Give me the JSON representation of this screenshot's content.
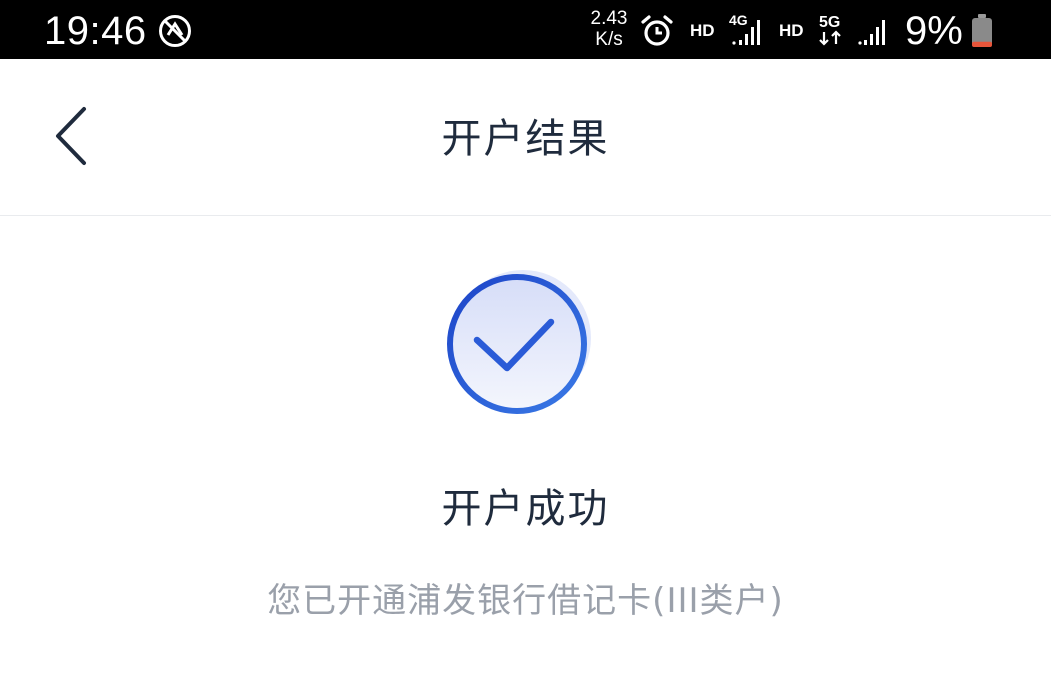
{
  "status_bar": {
    "time": "19:46",
    "net_speed_value": "2.43",
    "net_speed_unit": "K/s",
    "hd_label_1": "HD",
    "network_1": "4G",
    "hd_label_2": "HD",
    "network_2": "5G",
    "battery_percent": "9%",
    "battery_level": 0.09,
    "battery_color": "#e8553a",
    "icons": [
      "dnd-icon",
      "alarm-icon",
      "signal-icon",
      "battery-icon"
    ]
  },
  "nav": {
    "title": "开户结果",
    "back_icon": "chevron-left-icon"
  },
  "result": {
    "icon": "check-circle-icon",
    "accent_color": "#2a5bd7",
    "title": "开户成功",
    "description": "您已开通浦发银行借记卡(III类户)"
  }
}
